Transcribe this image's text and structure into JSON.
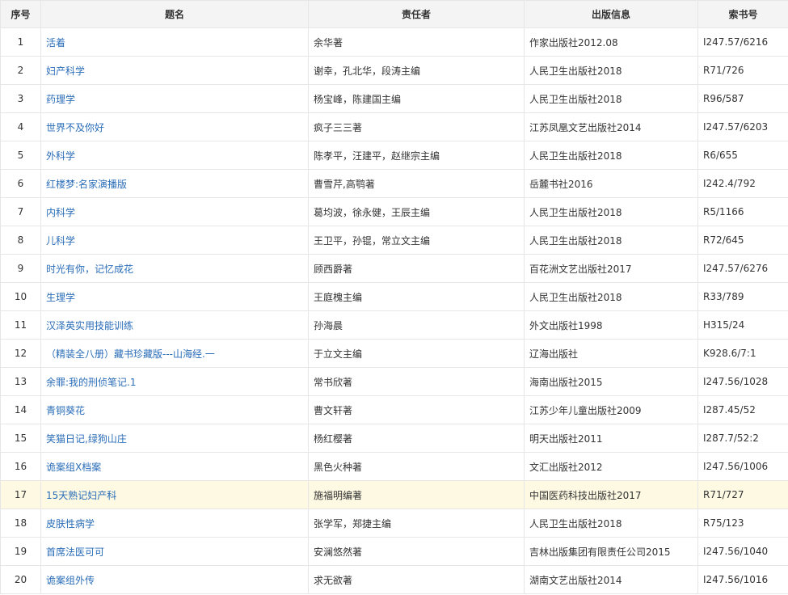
{
  "headers": [
    "序号",
    "题名",
    "责任者",
    "出版信息",
    "索书号"
  ],
  "rows": [
    {
      "no": "1",
      "title": "活着",
      "author": "余华著",
      "pub": "作家出版社2012.08",
      "call": "I247.57/6216"
    },
    {
      "no": "2",
      "title": "妇产科学",
      "author": "谢幸，孔北华，段涛主编",
      "pub": "人民卫生出版社2018",
      "call": "R71/726"
    },
    {
      "no": "3",
      "title": "药理学",
      "author": "杨宝峰，陈建国主编",
      "pub": "人民卫生出版社2018",
      "call": "R96/587"
    },
    {
      "no": "4",
      "title": "世界不及你好",
      "author": "疯子三三著",
      "pub": "江苏凤凰文艺出版社2014",
      "call": "I247.57/6203"
    },
    {
      "no": "5",
      "title": "外科学",
      "author": "陈孝平，汪建平，赵继宗主编",
      "pub": "人民卫生出版社2018",
      "call": "R6/655"
    },
    {
      "no": "6",
      "title": "红楼梦:名家演播版",
      "author": "曹雪芹,高鹗著",
      "pub": "岳麓书社2016",
      "call": "I242.4/792"
    },
    {
      "no": "7",
      "title": "内科学",
      "author": "葛均波，徐永健，王辰主编",
      "pub": "人民卫生出版社2018",
      "call": "R5/1166"
    },
    {
      "no": "8",
      "title": "儿科学",
      "author": "王卫平，孙锟，常立文主编",
      "pub": "人民卫生出版社2018",
      "call": "R72/645"
    },
    {
      "no": "9",
      "title": "时光有你，记忆成花",
      "author": "顾西爵著",
      "pub": "百花洲文艺出版社2017",
      "call": "I247.57/6276"
    },
    {
      "no": "10",
      "title": "生理学",
      "author": "王庭槐主编",
      "pub": "人民卫生出版社2018",
      "call": "R33/789"
    },
    {
      "no": "11",
      "title": "汉泽英实用技能训练",
      "author": "孙海晨",
      "pub": "外文出版社1998",
      "call": "H315/24"
    },
    {
      "no": "12",
      "title": "（精装全八册）藏书珍藏版---山海经.一",
      "author": "于立文主编",
      "pub": "辽海出版社",
      "call": "K928.6/7:1"
    },
    {
      "no": "13",
      "title": "余罪:我的刑侦笔记.1",
      "author": "常书欣著",
      "pub": "海南出版社2015",
      "call": "I247.56/1028"
    },
    {
      "no": "14",
      "title": "青铜葵花",
      "author": "曹文轩著",
      "pub": "江苏少年儿童出版社2009",
      "call": "I287.45/52"
    },
    {
      "no": "15",
      "title": "笑猫日记,绿狗山庄",
      "author": "杨红樱著",
      "pub": "明天出版社2011",
      "call": "I287.7/52:2"
    },
    {
      "no": "16",
      "title": "诡案组X档案",
      "author": "黑色火种著",
      "pub": "文汇出版社2012",
      "call": "I247.56/1006"
    },
    {
      "no": "17",
      "title": "15天熟记妇产科",
      "author": "施福明编著",
      "pub": "中国医药科技出版社2017",
      "call": "R71/727"
    },
    {
      "no": "18",
      "title": "皮肤性病学",
      "author": "张学军，郑捷主编",
      "pub": "人民卫生出版社2018",
      "call": "R75/123"
    },
    {
      "no": "19",
      "title": "首席法医可可",
      "author": "安澜悠然著",
      "pub": "吉林出版集团有限责任公司2015",
      "call": "I247.56/1040"
    },
    {
      "no": "20",
      "title": "诡案组外传",
      "author": "求无欲著",
      "pub": "湖南文艺出版社2014",
      "call": "I247.56/1016"
    }
  ],
  "highlight_row": "17",
  "colors": {
    "link": "#2a6db8",
    "header_bg": "#f4f4f4",
    "highlight_bg": "#fdf9e3",
    "border": "#e6e6e6"
  }
}
